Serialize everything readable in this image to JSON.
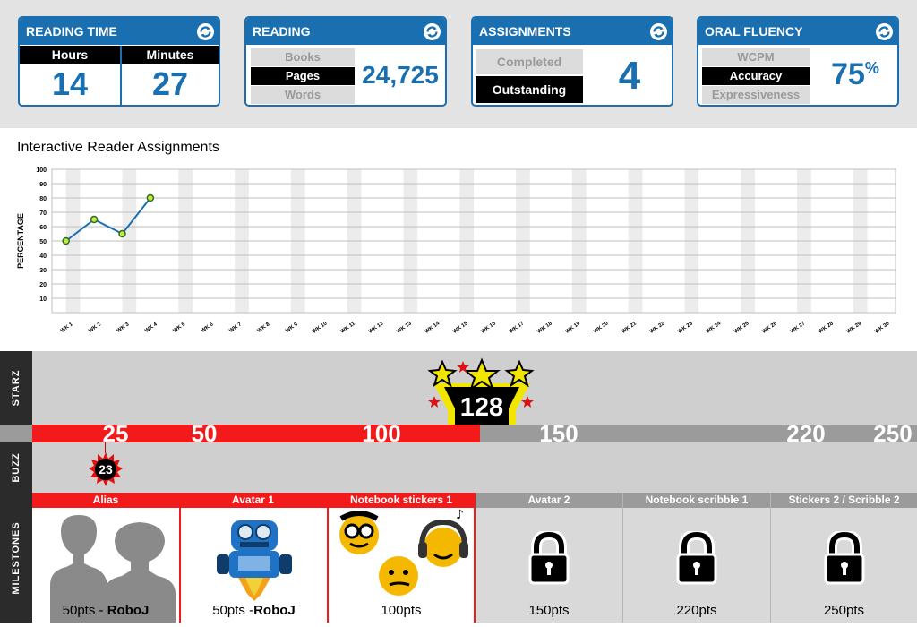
{
  "cards": {
    "reading_time": {
      "title": "READING TIME",
      "hours_label": "Hours",
      "hours": "14",
      "minutes_label": "Minutes",
      "minutes": "27"
    },
    "reading": {
      "title": "READING",
      "options": [
        "Books",
        "Pages",
        "Words"
      ],
      "selected": "Pages",
      "value": "24,725"
    },
    "assignments": {
      "title": "ASSIGNMENTS",
      "options": [
        "Completed",
        "Outstanding"
      ],
      "selected": "Outstanding",
      "value": "4"
    },
    "oral_fluency": {
      "title": "ORAL FLUENCY",
      "options": [
        "WCPM",
        "Accuracy",
        "Expressiveness"
      ],
      "selected": "Accuracy",
      "value": "75",
      "unit": "%"
    }
  },
  "chart_title": "Interactive Reader Assignments",
  "chart_data": {
    "type": "line",
    "title": "Interactive Reader Assignments",
    "ylabel": "PERCENTAGE",
    "xlabel": "",
    "ylim": [
      0,
      100
    ],
    "yticks": [
      10,
      20,
      30,
      40,
      50,
      60,
      70,
      80,
      90,
      100
    ],
    "categories": [
      "WK 1",
      "WK 2",
      "WK 3",
      "WK 4",
      "WK 5",
      "WK 6",
      "WK 7",
      "WK 8",
      "WK 9",
      "WK 10",
      "WK 11",
      "WK 12",
      "WK 13",
      "WK 14",
      "WK 15",
      "WK 16",
      "WK 17",
      "WK 18",
      "WK 19",
      "WK 20",
      "WK 21",
      "WK 22",
      "WK 23",
      "WK 24",
      "WK 25",
      "WK 26",
      "WK 27",
      "WK 28",
      "WK 29",
      "WK 30"
    ],
    "series": [
      {
        "values": [
          50,
          65,
          55,
          80
        ]
      }
    ],
    "grid": true,
    "colors": {
      "line": "#1a6fb0",
      "marker_fill": "#c8e63c",
      "marker_stroke": "#2a6e2a",
      "band": "#ececec"
    }
  },
  "starz": {
    "label": "STARZ",
    "count": "128",
    "current_value": 128,
    "max_value": 250,
    "markers": [
      "25",
      "50",
      "100",
      "150",
      "220",
      "250"
    ]
  },
  "buzz": {
    "label": "BUZZ",
    "count": "23"
  },
  "milestones": {
    "label": "MILESTONES",
    "items": [
      {
        "title": "Alias",
        "pts": "50pts",
        "sep": " -",
        "who": "RoboJ",
        "icon": "user-silhouettes-icon",
        "unlocked": true
      },
      {
        "title": "Avatar 1",
        "pts": "50pts",
        "sep": " -",
        "who": "RoboJ",
        "icon": "robot-avatar-icon",
        "unlocked": true
      },
      {
        "title": "Notebook stickers 1",
        "pts": "100pts",
        "sep": "",
        "who": "",
        "icon": "emoji-stickers-icon",
        "unlocked": true
      },
      {
        "title": "Avatar 2",
        "pts": "150pts",
        "sep": "",
        "who": "",
        "icon": "lock-icon",
        "unlocked": false
      },
      {
        "title": "Notebook scribble 1",
        "pts": "220pts",
        "sep": "",
        "who": "",
        "icon": "lock-icon",
        "unlocked": false
      },
      {
        "title": "Stickers 2 / Scribble 2",
        "pts": "250pts",
        "sep": "",
        "who": "",
        "icon": "lock-icon",
        "unlocked": false
      }
    ]
  },
  "colors": {
    "brand_blue": "#1a6fb0",
    "progress_red": "#f21a1a",
    "progress_gray": "#9b9b9b"
  }
}
